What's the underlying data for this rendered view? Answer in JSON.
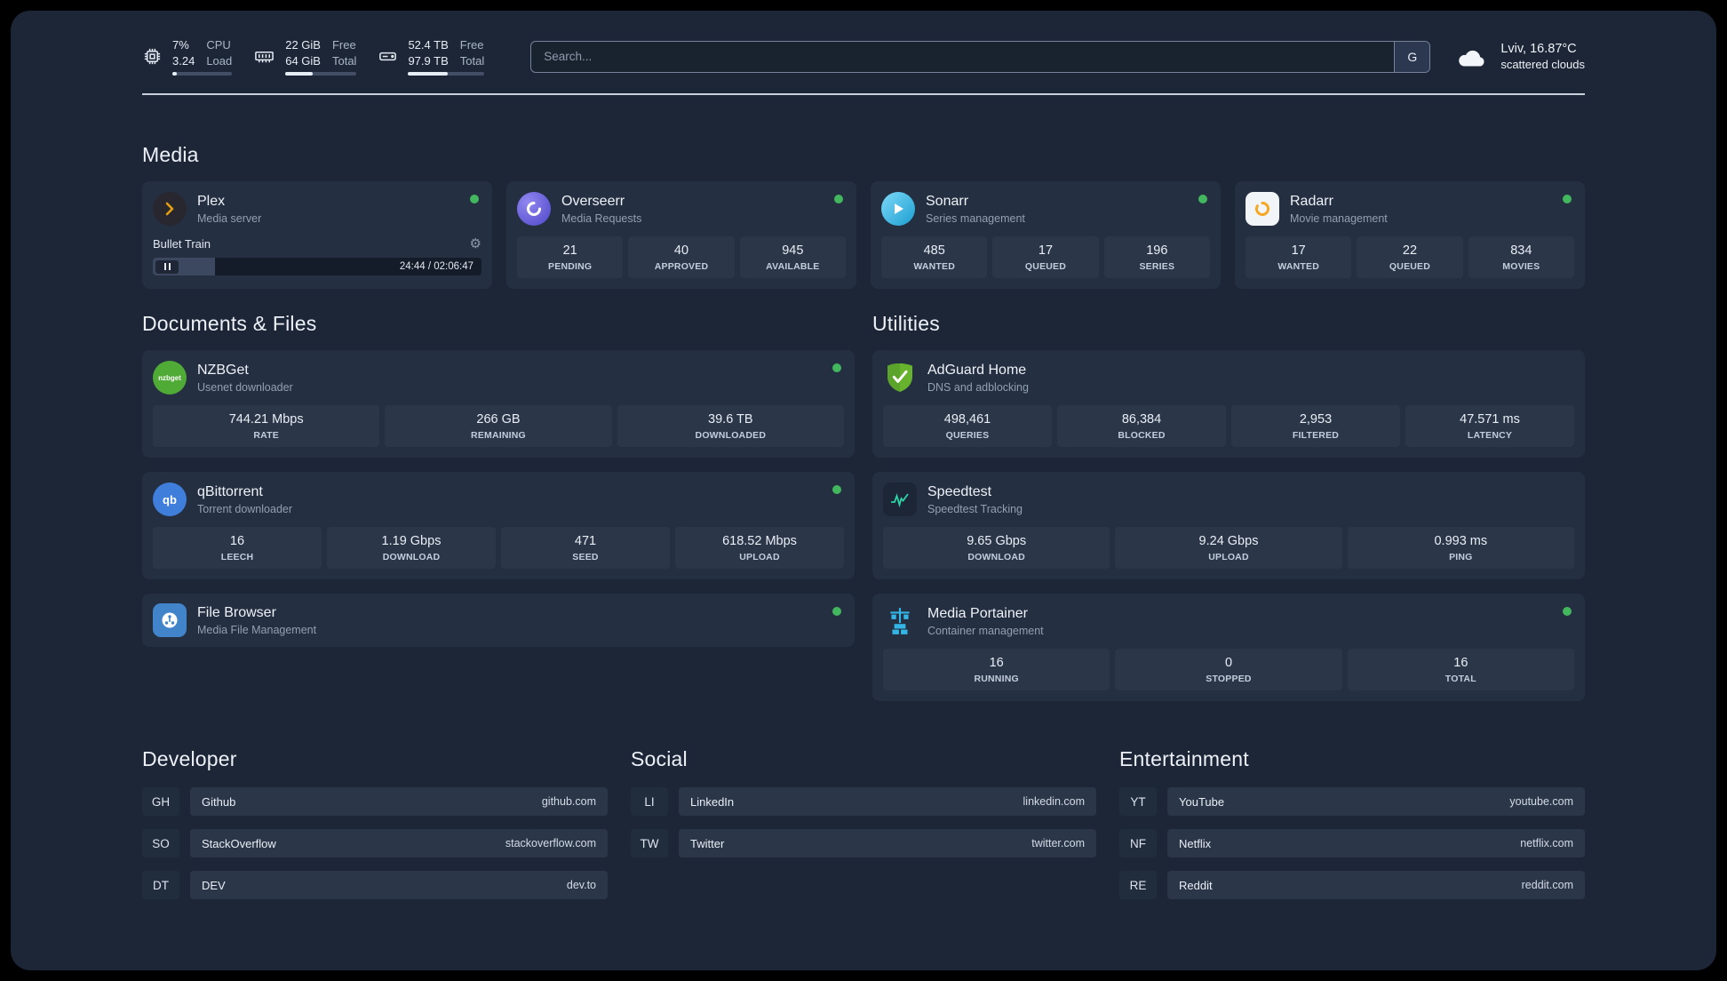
{
  "topbar": {
    "cpu": {
      "value1": "7%",
      "value2": "3.24",
      "label1": "CPU",
      "label2": "Load",
      "progress": 8
    },
    "memory": {
      "value1": "22 GiB",
      "value2": "64 GiB",
      "label1": "Free",
      "label2": "Total",
      "progress": 38
    },
    "disk": {
      "value1": "52.4 TB",
      "value2": "97.9 TB",
      "label1": "Free",
      "label2": "Total",
      "progress": 52
    },
    "search": {
      "placeholder": "Search...",
      "button_label": "G"
    },
    "weather": {
      "location": "Lviv, 16.87°C",
      "condition": "scattered clouds"
    }
  },
  "media": {
    "title": "Media",
    "plex": {
      "name": "Plex",
      "subtitle": "Media server",
      "now_playing": "Bullet Train",
      "time": "24:44 / 02:06:47",
      "progress": 19
    },
    "overseerr": {
      "name": "Overseerr",
      "subtitle": "Media Requests",
      "stats": [
        {
          "value": "21",
          "label": "PENDING"
        },
        {
          "value": "40",
          "label": "APPROVED"
        },
        {
          "value": "945",
          "label": "AVAILABLE"
        }
      ]
    },
    "sonarr": {
      "name": "Sonarr",
      "subtitle": "Series management",
      "stats": [
        {
          "value": "485",
          "label": "WANTED"
        },
        {
          "value": "17",
          "label": "QUEUED"
        },
        {
          "value": "196",
          "label": "SERIES"
        }
      ]
    },
    "radarr": {
      "name": "Radarr",
      "subtitle": "Movie management",
      "stats": [
        {
          "value": "17",
          "label": "WANTED"
        },
        {
          "value": "22",
          "label": "QUEUED"
        },
        {
          "value": "834",
          "label": "MOVIES"
        }
      ]
    }
  },
  "documents": {
    "title": "Documents & Files",
    "nzbget": {
      "name": "NZBGet",
      "subtitle": "Usenet downloader",
      "stats": [
        {
          "value": "744.21 Mbps",
          "label": "RATE"
        },
        {
          "value": "266 GB",
          "label": "REMAINING"
        },
        {
          "value": "39.6 TB",
          "label": "DOWNLOADED"
        }
      ]
    },
    "qbittorrent": {
      "name": "qBittorrent",
      "subtitle": "Torrent downloader",
      "stats": [
        {
          "value": "16",
          "label": "LEECH"
        },
        {
          "value": "1.19 Gbps",
          "label": "DOWNLOAD"
        },
        {
          "value": "471",
          "label": "SEED"
        },
        {
          "value": "618.52 Mbps",
          "label": "UPLOAD"
        }
      ]
    },
    "filebrowser": {
      "name": "File Browser",
      "subtitle": "Media File Management"
    }
  },
  "utilities": {
    "title": "Utilities",
    "adguard": {
      "name": "AdGuard Home",
      "subtitle": "DNS and adblocking",
      "stats": [
        {
          "value": "498,461",
          "label": "QUERIES"
        },
        {
          "value": "86,384",
          "label": "BLOCKED"
        },
        {
          "value": "2,953",
          "label": "FILTERED"
        },
        {
          "value": "47.571 ms",
          "label": "LATENCY"
        }
      ]
    },
    "speedtest": {
      "name": "Speedtest",
      "subtitle": "Speedtest Tracking",
      "stats": [
        {
          "value": "9.65 Gbps",
          "label": "DOWNLOAD"
        },
        {
          "value": "9.24 Gbps",
          "label": "UPLOAD"
        },
        {
          "value": "0.993 ms",
          "label": "PING"
        }
      ]
    },
    "portainer": {
      "name": "Media Portainer",
      "subtitle": "Container management",
      "stats": [
        {
          "value": "16",
          "label": "RUNNING"
        },
        {
          "value": "0",
          "label": "STOPPED"
        },
        {
          "value": "16",
          "label": "TOTAL"
        }
      ]
    }
  },
  "bookmarks": {
    "developer": {
      "title": "Developer",
      "items": [
        {
          "abbr": "GH",
          "name": "Github",
          "url": "github.com"
        },
        {
          "abbr": "SO",
          "name": "StackOverflow",
          "url": "stackoverflow.com"
        },
        {
          "abbr": "DT",
          "name": "DEV",
          "url": "dev.to"
        }
      ]
    },
    "social": {
      "title": "Social",
      "items": [
        {
          "abbr": "LI",
          "name": "LinkedIn",
          "url": "linkedin.com"
        },
        {
          "abbr": "TW",
          "name": "Twitter",
          "url": "twitter.com"
        }
      ]
    },
    "entertainment": {
      "title": "Entertainment",
      "items": [
        {
          "abbr": "YT",
          "name": "YouTube",
          "url": "youtube.com"
        },
        {
          "abbr": "NF",
          "name": "Netflix",
          "url": "netflix.com"
        },
        {
          "abbr": "RE",
          "name": "Reddit",
          "url": "reddit.com"
        }
      ]
    }
  },
  "colors": {
    "status_online": "#43b75d",
    "adguard_green": "#67b32e",
    "plex_amber": "#e5a00d"
  }
}
